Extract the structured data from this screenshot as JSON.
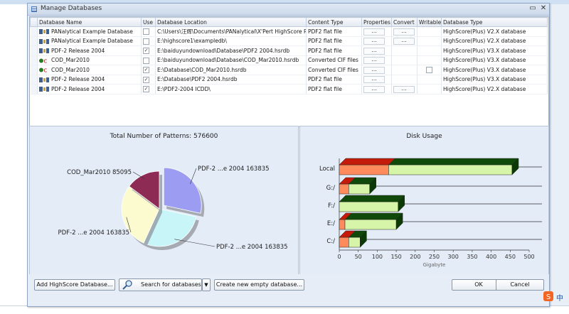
{
  "window": {
    "title": "Manage Databases",
    "minimize_glyph": "▭",
    "close_glyph": "✕"
  },
  "grid": {
    "headers": [
      "Database Name",
      "Use",
      "Database Location",
      "Content Type",
      "Properties",
      "Convert",
      "Writable",
      "Database Type"
    ],
    "rows": [
      {
        "icon": "hsdb-icon",
        "name": "PANalytical Example Database",
        "use": false,
        "location": "C:\\Users\\汪辉\\Documents\\PANalytical\\X'Pert HighScore Pl",
        "content": "PDF2 flat file",
        "properties": "...",
        "convert": "...",
        "writable": null,
        "type": "HighScore(Plus) V2.X database"
      },
      {
        "icon": "hsdb-icon",
        "name": "PANalytical Example Database",
        "use": false,
        "location": "E:\\highscore1\\exampledb\\",
        "content": "PDF2 flat file",
        "properties": "...",
        "convert": "...",
        "writable": null,
        "type": "HighScore(Plus) V2.X database"
      },
      {
        "icon": "hsdb-icon",
        "name": "PDF-2 Release 2004",
        "use": true,
        "location": "E:\\baiduyundownload\\Database\\PDF2 2004.hsrdb",
        "content": "PDF2 flat file",
        "properties": "...",
        "convert": "",
        "writable": null,
        "type": "HighScore(Plus) V3.X database"
      },
      {
        "icon": "cod-icon",
        "name": "COD_Mar2010",
        "use": false,
        "location": "E:\\baiduyundownload\\Database\\COD_Mar2010.hsrdb",
        "content": "Converted CIF files",
        "properties": "...",
        "convert": "",
        "writable": null,
        "type": "HighScore(Plus) V3.X database"
      },
      {
        "icon": "cod-icon",
        "name": "COD_Mar2010",
        "use": true,
        "location": "E:\\Database\\COD_Mar2010.hsrdb",
        "content": "Converted CIF files",
        "properties": "...",
        "convert": "",
        "writable": false,
        "type": "HighScore(Plus) V3.X database"
      },
      {
        "icon": "hsdb-icon",
        "name": "PDF-2 Release 2004",
        "use": true,
        "location": "E:\\Database\\PDF2 2004.hsrdb",
        "content": "PDF2 flat file",
        "properties": "...",
        "convert": "",
        "writable": null,
        "type": "HighScore(Plus) V3.X database"
      },
      {
        "icon": "hsdb-icon",
        "name": "PDF-2 Release 2004",
        "use": true,
        "location": "E:\\PDF2-2004 ICDD\\",
        "content": "PDF2 flat file",
        "properties": "...",
        "convert": "...",
        "writable": null,
        "type": "HighScore(Plus) V2.X database"
      }
    ]
  },
  "pie": {
    "title": "Total Number of Patterns: 576600",
    "labels": [
      "PDF-2 ...e 2004 163835",
      "PDF-2 ...e 2004 163835",
      "PDF-2 ...e 2004 163835",
      "COD_Mar2010 85095"
    ]
  },
  "chart_data": [
    {
      "type": "pie",
      "title": "Total Number of Patterns: 576600",
      "slices": [
        {
          "label": "PDF-2 ...e 2004",
          "value": 163835,
          "color": "#9b9cf2"
        },
        {
          "label": "PDF-2 ...e 2004",
          "value": 163835,
          "color": "#c8f5f7"
        },
        {
          "label": "PDF-2 ...e 2004",
          "value": 163835,
          "color": "#fbfbcf"
        },
        {
          "label": "COD_Mar2010",
          "value": 85095,
          "color": "#8e2b55"
        }
      ]
    },
    {
      "type": "bar",
      "orientation": "horizontal",
      "title": "Disk Usage",
      "categories": [
        "Local",
        "G:/",
        "F:/",
        "E:/",
        "C:/"
      ],
      "series": [
        {
          "values": [
            130,
            25,
            0,
            15,
            25
          ],
          "color": "#d41e0e"
        },
        {
          "values": [
            325,
            55,
            155,
            135,
            30
          ],
          "color": "#1f6e12"
        }
      ],
      "xlabel": "Gigabyte",
      "xticks": [
        0,
        50,
        100,
        150,
        200,
        250,
        300,
        350,
        400,
        450,
        500
      ],
      "xlim": [
        0,
        500
      ]
    }
  ],
  "disk": {
    "title": "Disk Usage",
    "xlabel": "Gigabyte"
  },
  "buttons": {
    "add": "Add HighScore Database...",
    "search": "Search for databases",
    "create": "Create new empty database...",
    "ok": "OK",
    "cancel": "Cancel"
  },
  "ime": {
    "label": "中"
  }
}
